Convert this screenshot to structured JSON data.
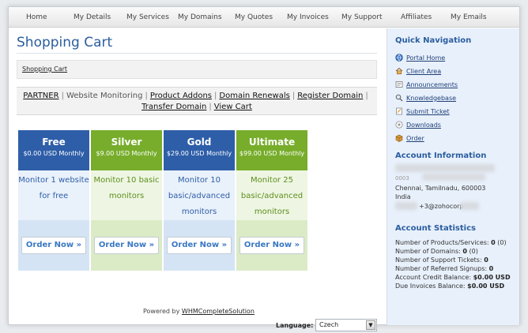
{
  "topnav": [
    "Home",
    "My Details",
    "My Services",
    "My Domains",
    "My Quotes",
    "My Invoices",
    "My Support",
    "Affiliates",
    "My Emails"
  ],
  "page": {
    "title": "Shopping Cart",
    "breadcrumb": "Shopping Cart"
  },
  "subnav": {
    "partner": "PARTNER",
    "current": "Website Monitoring",
    "product_addons": "Product Addons",
    "domain_renewals": "Domain Renewals",
    "register_domain": "Register Domain",
    "transfer_domain": "Transfer Domain",
    "view_cart": "View Cart",
    "separator": "|"
  },
  "plans": [
    {
      "name": "Free",
      "price": "$0.00 USD Monthly",
      "desc1": "Monitor 1 website",
      "desc2": "for free",
      "desc3": "",
      "order": "Order Now »",
      "color": "#2e5ea8"
    },
    {
      "name": "Silver",
      "price": "$9.00 USD Monthly",
      "desc1": "Monitor 10 basic",
      "desc2": "monitors",
      "desc3": "",
      "order": "Order Now »",
      "color": "#77ad2b"
    },
    {
      "name": "Gold",
      "price": "$29.00 USD Monthly",
      "desc1": "Monitor 10",
      "desc2": "basic/advanced",
      "desc3": "monitors",
      "order": "Order Now »",
      "color": "#2e5ea8"
    },
    {
      "name": "Ultimate",
      "price": "$99.00 USD Monthly",
      "desc1": "Monitor 25",
      "desc2": "basic/advanced",
      "desc3": "monitors",
      "order": "Order Now »",
      "color": "#77ad2b"
    }
  ],
  "footer": {
    "powered_by": "Powered by",
    "powered_link": "WHMCompleteSolution",
    "language_label": "Language:",
    "language_value": "Czech"
  },
  "sidebar": {
    "quick_nav_title": "Quick Navigation",
    "quick_nav": [
      {
        "label": "Portal Home",
        "icon": "globe-icon"
      },
      {
        "label": "Client Area",
        "icon": "home-icon"
      },
      {
        "label": "Announcements",
        "icon": "newspaper-icon"
      },
      {
        "label": "Knowledgebase",
        "icon": "magnifier-icon"
      },
      {
        "label": "Submit Ticket",
        "icon": "ticket-icon"
      },
      {
        "label": "Downloads",
        "icon": "download-icon"
      },
      {
        "label": "Order",
        "icon": "box-icon"
      }
    ],
    "account_info_title": "Account Information",
    "account_info": {
      "partial_line": "0003",
      "address": "Chennai, Tamilnadu, 600003",
      "country": "India",
      "email_fragment": "+3@zohocorp"
    },
    "account_stats_title": "Account Statistics",
    "stats": [
      {
        "label": "Number of Products/Services:",
        "value": "0",
        "extra": "(0)"
      },
      {
        "label": "Number of Domains:",
        "value": "0",
        "extra": "(0)"
      },
      {
        "label": "Number of Support Tickets:",
        "value": "0",
        "extra": ""
      },
      {
        "label": "Number of Referred Signups:",
        "value": "0",
        "extra": ""
      },
      {
        "label": "Account Credit Balance:",
        "value": "$0.00 USD",
        "extra": ""
      },
      {
        "label": "Due Invoices Balance:",
        "value": "$0.00 USD",
        "extra": ""
      }
    ]
  }
}
